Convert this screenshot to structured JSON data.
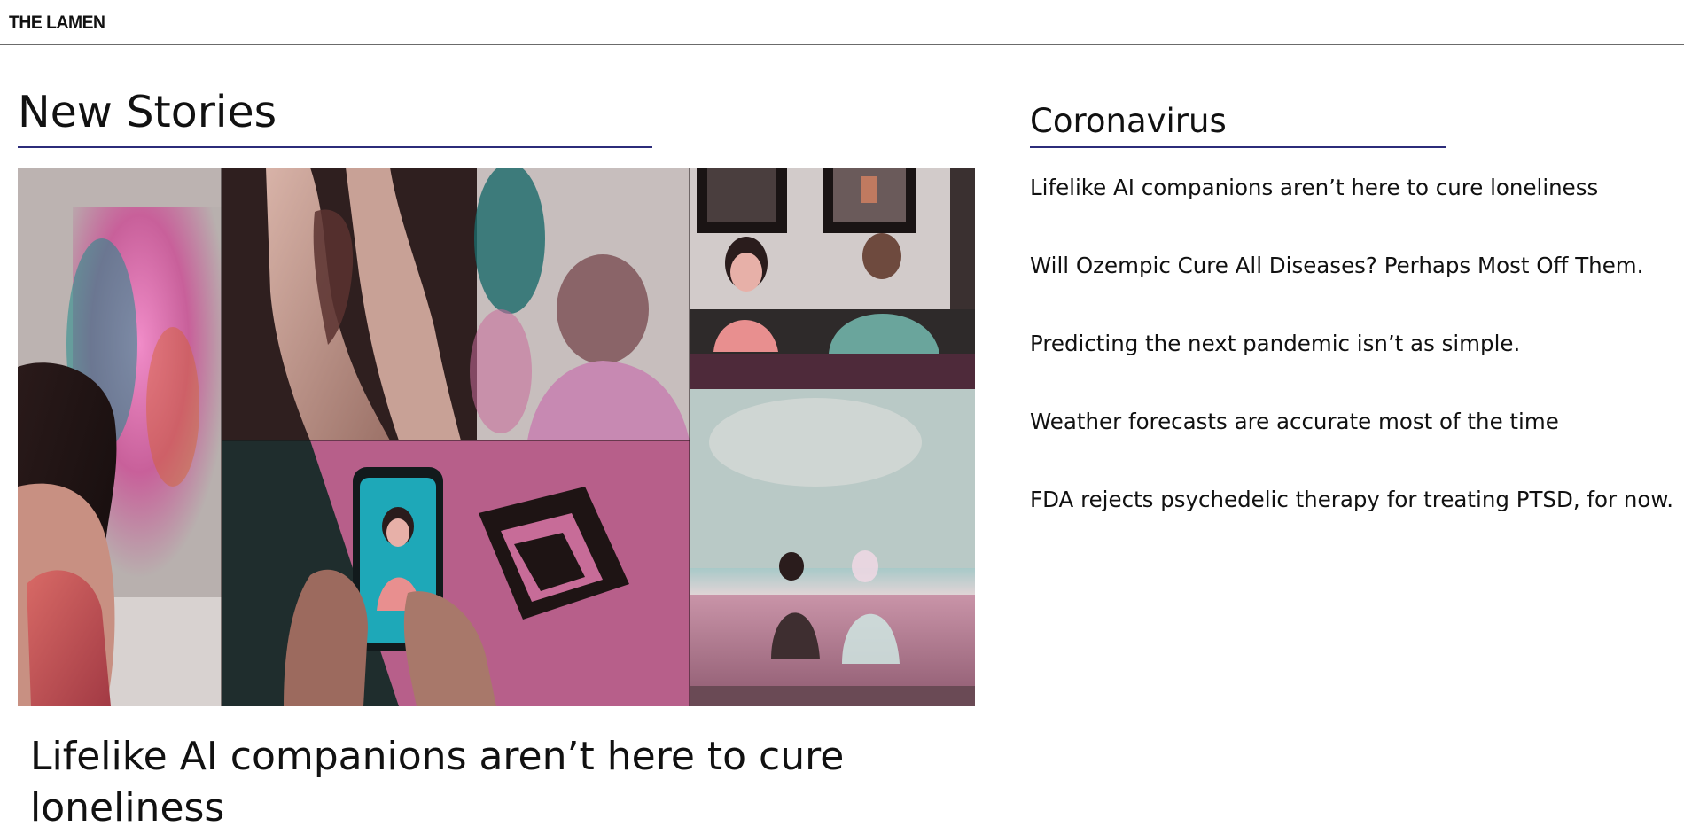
{
  "site": {
    "logo": "THE LAMEN"
  },
  "main": {
    "section_title": "New Stories",
    "featured": {
      "headline": "Lifelike AI companions aren’t here to cure loneliness"
    }
  },
  "sidebar": {
    "title": "Coronavirus",
    "stories": [
      "Lifelike AI companions aren’t here to cure loneliness",
      "Will Ozempic Cure All Diseases? Perhaps Most Off Them.",
      "Predicting the next pandemic isn’t as simple.",
      "Weather forecasts are accurate most of the time",
      "FDA rejects psychedelic therapy for treating PTSD, for now."
    ]
  },
  "colors": {
    "accent_rule": "#2c2c7a",
    "text": "#111111",
    "background": "#ffffff"
  }
}
